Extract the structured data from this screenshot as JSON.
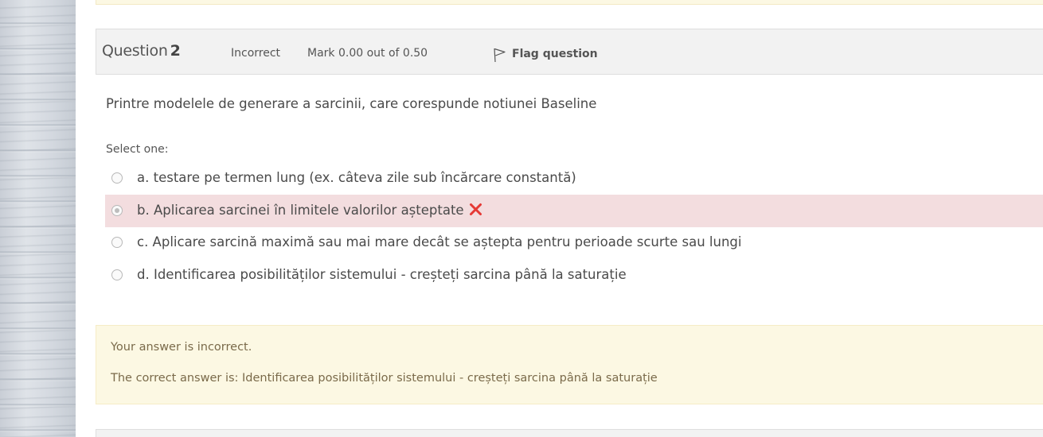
{
  "question": {
    "label": "Question",
    "number": "2",
    "state": "Incorrect",
    "grade": "Mark 0.00 out of 0.50",
    "flag_label": "Flag question",
    "text": "Printre modelele de generare a sarcinii, care corespunde notiunei Baseline",
    "prompt": "Select one:"
  },
  "answers": [
    {
      "label": "a. testare pe termen lung (ex. câteva zile sub încărcare constantă)",
      "selected": false,
      "status": ""
    },
    {
      "label": "b. Aplicarea sarcinei în limitele valorilor așteptate",
      "selected": true,
      "status": "incorrect"
    },
    {
      "label": "c. Aplicare sarcină maximă sau mai mare decât se aștepta pentru perioade scurte sau lungi",
      "selected": false,
      "status": ""
    },
    {
      "label": "d. Identificarea posibilităților sistemului - creșteți sarcina până la saturație",
      "selected": false,
      "status": ""
    }
  ],
  "feedback": {
    "summary": "Your answer is incorrect.",
    "correct_answer": "The correct answer is: Identificarea posibilităților sistemului - creșteți sarcina până la saturație"
  },
  "colors": {
    "incorrect_bg": "#f3dddf",
    "feedback_bg": "#fcf8e3",
    "header_bg": "#f2f2f2",
    "x_mark": "#e53935"
  },
  "icons": {
    "flag": "flag-icon",
    "incorrect": "cross-icon"
  }
}
